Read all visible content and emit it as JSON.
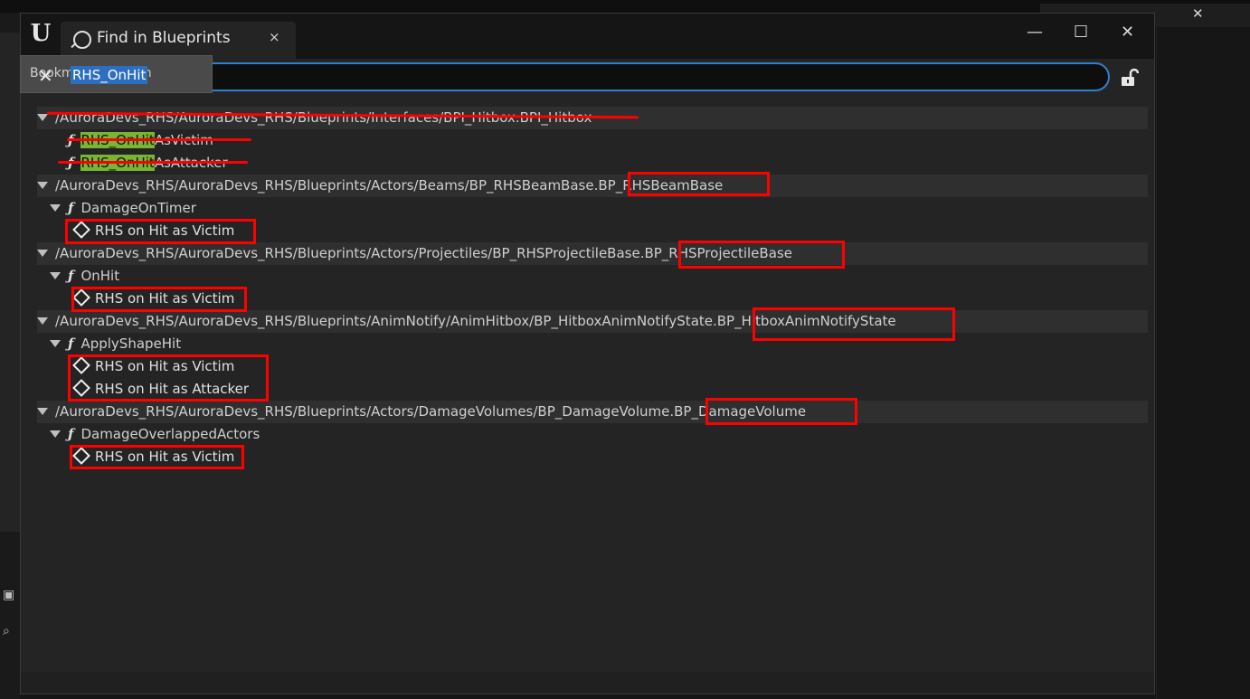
{
  "window": {
    "tab_title": "Find in Blueprints",
    "close_tab": "×",
    "minimize": "—",
    "maximize": "☐",
    "close": "✕"
  },
  "background": {
    "tooltip_text": "Bookmark Location",
    "right_panel_close": "✕"
  },
  "search": {
    "value": "RHS_OnHit",
    "clear": "✕"
  },
  "results": {
    "groups": [
      {
        "path": "/AuroraDevs_RHS/AuroraDevs_RHS/Blueprints/Interfaces/BPI_Hitbox.BPI_Hitbox",
        "items": [
          {
            "type": "function",
            "match": "RHS_OnHit",
            "rest": "AsVictim"
          },
          {
            "type": "function",
            "match": "RHS_OnHit",
            "rest": "AsAttacker"
          }
        ]
      },
      {
        "path": "/AuroraDevs_RHS/AuroraDevs_RHS/Blueprints/Actors/Beams/BP_RHSBeamBase.",
        "asset": "BP_RHSBeamBase",
        "function": "DamageOnTimer",
        "nodes": [
          "RHS on Hit as Victim"
        ]
      },
      {
        "path": "/AuroraDevs_RHS/AuroraDevs_RHS/Blueprints/Actors/Projectiles/BP_RHSProjectileBase.",
        "asset": "BP_RHSProjectileBase",
        "function": "OnHit",
        "nodes": [
          "RHS on Hit as Victim"
        ]
      },
      {
        "path": "/AuroraDevs_RHS/AuroraDevs_RHS/Blueprints/AnimNotify/AnimHitbox/BP_HitboxAnimNotifyState.",
        "asset": "BP_HitboxAnimNotifyState",
        "function": "ApplyShapeHit",
        "nodes": [
          "RHS on Hit as Victim",
          "RHS on Hit as Attacker"
        ]
      },
      {
        "path": "/AuroraDevs_RHS/AuroraDevs_RHS/Blueprints/Actors/DamageVolumes/BP_DamageVolume.",
        "asset": "BP_DamageVolume",
        "function": "DamageOverlappedActors",
        "nodes": [
          "RHS on Hit as Victim"
        ]
      }
    ]
  },
  "icons": {
    "function_glyph": "ƒ",
    "logo": "U"
  },
  "colors": {
    "accent": "#2f7fd0",
    "match_highlight": "#7ab532",
    "annotation_red": "#ff0000"
  }
}
